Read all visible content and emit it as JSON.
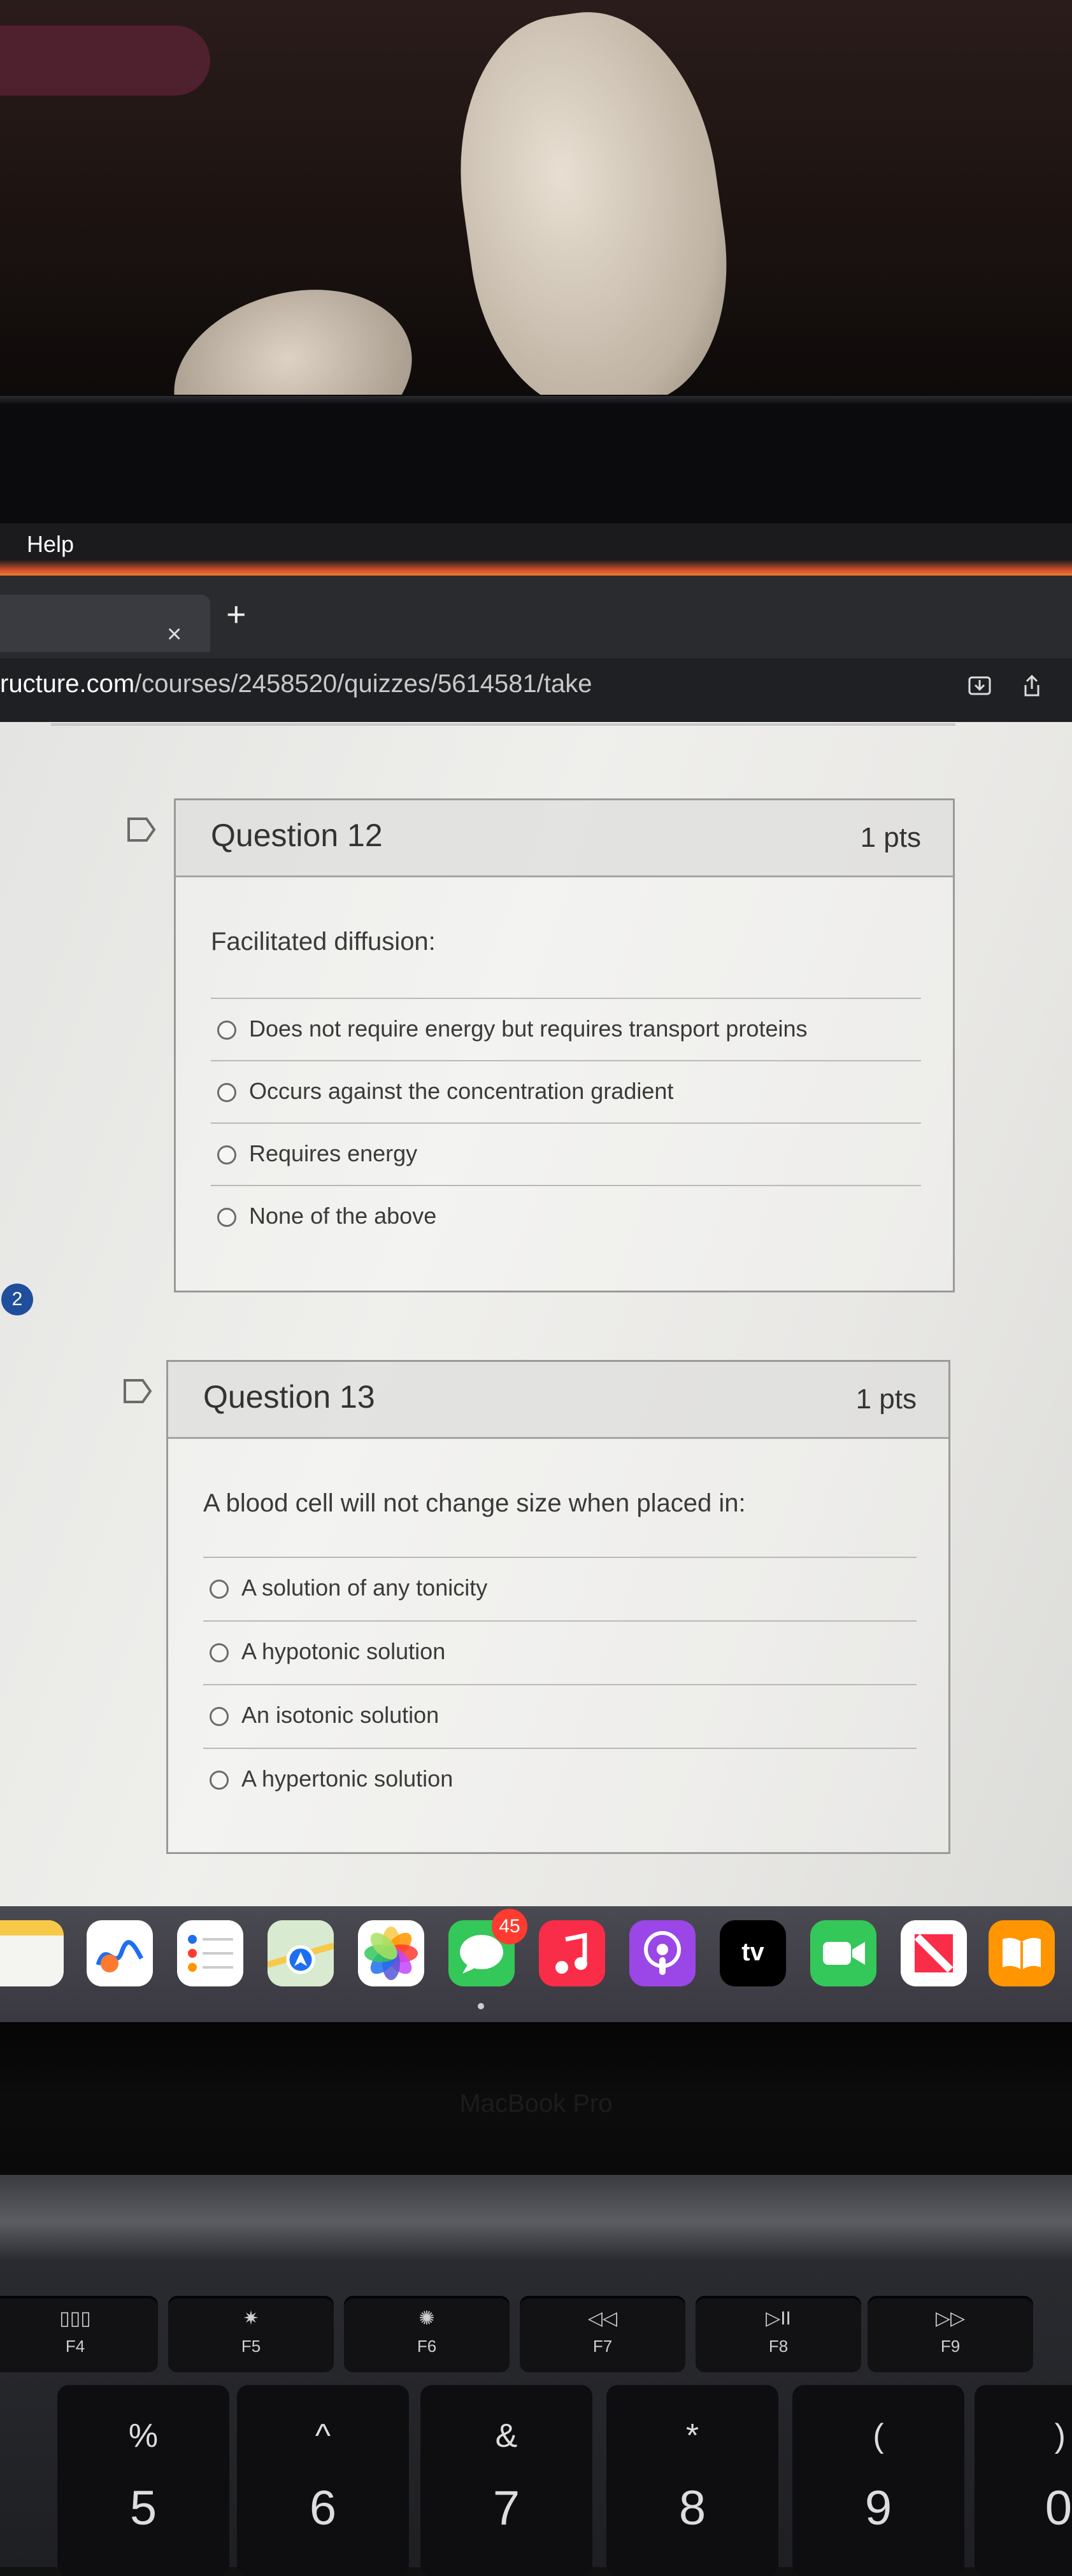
{
  "menubar": {
    "help": "Help"
  },
  "browser": {
    "tab_close": "×",
    "tab_new": "+",
    "url_domain": "ructure.com",
    "url_path": "/courses/2458520/quizzes/5614581/take"
  },
  "quiz": {
    "side_badge": "2",
    "questions": [
      {
        "title": "Question 12",
        "points": "1 pts",
        "text": "Facilitated diffusion:",
        "answers": [
          "Does not require energy but requires transport proteins",
          "Occurs against the concentration gradient",
          "Requires energy",
          "None of the above"
        ]
      },
      {
        "title": "Question 13",
        "points": "1 pts",
        "text": "A blood cell will not change size when placed in:",
        "answers": [
          "A solution of any tonicity",
          "A hypotonic solution",
          "An isotonic solution",
          "A hypertonic solution"
        ]
      }
    ]
  },
  "dock": {
    "apps": [
      "notes-icon",
      "freeform-icon",
      "reminders-icon",
      "maps-icon",
      "photos-icon",
      "messages-icon",
      "music-icon",
      "podcasts-icon",
      "apple-tv-icon",
      "facetime-icon",
      "news-icon",
      "books-icon"
    ],
    "messages_badge": "45",
    "tv_label": "tv"
  },
  "laptop": {
    "label": "MacBook Pro",
    "fkeys": [
      {
        "glyph": "▯▯▯",
        "label": "F4"
      },
      {
        "glyph": "✷",
        "label": "F5"
      },
      {
        "glyph": "✺",
        "label": "F6"
      },
      {
        "glyph": "◁◁",
        "label": "F7"
      },
      {
        "glyph": "▷II",
        "label": "F8"
      },
      {
        "glyph": "▷▷",
        "label": "F9"
      }
    ],
    "number_keys": [
      {
        "top": "%",
        "bottom": "5"
      },
      {
        "top": "^",
        "bottom": "6"
      },
      {
        "top": "&",
        "bottom": "7"
      },
      {
        "top": "*",
        "bottom": "8"
      },
      {
        "top": "(",
        "bottom": "9"
      },
      {
        "top": ")",
        "bottom": "0"
      }
    ]
  }
}
